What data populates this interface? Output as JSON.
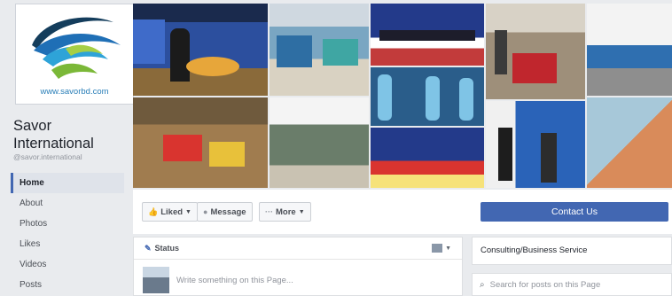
{
  "page": {
    "name": "Savor International",
    "handle": "@savor.international",
    "website": "www.savorbd.com"
  },
  "sidebar": {
    "items": [
      {
        "label": "Home",
        "active": true
      },
      {
        "label": "About"
      },
      {
        "label": "Photos"
      },
      {
        "label": "Likes"
      },
      {
        "label": "Videos"
      },
      {
        "label": "Posts"
      }
    ]
  },
  "cover": {
    "tiles": [
      {
        "subject": "conference-speaker-on-stage"
      },
      {
        "subject": "exhibition-booth-hall"
      },
      {
        "subject": "panel-seated-at-stage-table"
      },
      {
        "subject": "exhibition-visitors-red-machinery"
      },
      {
        "subject": "outdoor-exhibition-entrance"
      },
      {
        "subject": "exhibition-hall-crowd-overhead"
      },
      {
        "subject": "outdoor-blue-balloon-pillars"
      },
      {
        "subject": "exhibition-venue-exterior"
      },
      {
        "subject": "award-ceremony-on-stage"
      },
      {
        "subject": "people-at-blue-booth"
      },
      {
        "subject": "copper-coil-product-closeup"
      }
    ]
  },
  "actions": {
    "liked": "Liked",
    "message": "Message",
    "more": "More",
    "contact": "Contact Us"
  },
  "composer": {
    "tab": "Status",
    "placeholder": "Write something on this Page..."
  },
  "about": {
    "category": "Consulting/Business Service"
  },
  "search": {
    "placeholder": "Search for posts on this Page"
  },
  "colors": {
    "facebook_blue": "#4267b2",
    "background": "#e9ebee",
    "logo_blue": "#1f6fb6",
    "logo_green": "#7bb838"
  }
}
